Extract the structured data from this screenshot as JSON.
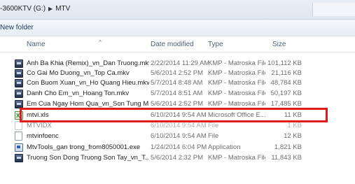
{
  "address": {
    "drive": "-3600KTV (G:)",
    "separator": "▶",
    "folder": "MTV"
  },
  "toolbar": {
    "new_folder_label": "New folder"
  },
  "columns": {
    "name": "Name",
    "date": "Date modified",
    "type": "Type",
    "size": "Size"
  },
  "files": [
    {
      "name": "Anh Ba Khia (Remix)_vn_Dan Truong.mkv",
      "date": "2/22/2014 11:29 AM",
      "type": "KMP - Matroska File",
      "size": "101,112 KB",
      "icon": "video-file-icon"
    },
    {
      "name": "Co Gai Mo Duong_vn_Top Ca.mkv",
      "date": "5/6/2014 2:52 PM",
      "type": "KMP - Matroska File",
      "size": "21,116 KB",
      "icon": "video-file-icon"
    },
    {
      "name": "Con Buom Xuan_vn_Ho Quang Hieu.mkv",
      "date": "5/7/2014 8:48 AM",
      "type": "KMP - Matroska File",
      "size": "48,784 KB",
      "icon": "video-file-icon"
    },
    {
      "name": "Danh Cho Em_vn_Hoang Ton.mkv",
      "date": "5/7/2014 8:51 AM",
      "type": "KMP - Matroska File",
      "size": "50,197 KB",
      "icon": "video-file-icon"
    },
    {
      "name": "Em Cua Ngay Hom Qua_vn_Son Tung M...",
      "date": "5/6/2014 2:52 PM",
      "type": "KMP - Matroska File",
      "size": "17,485 KB",
      "icon": "video-file-icon"
    },
    {
      "name": "mtvi.xls",
      "date": "6/10/2014 9:54 AM",
      "type": "Microsoft Office E...",
      "size": "11 KB",
      "icon": "excel-file-icon"
    },
    {
      "name": "MTVIDX",
      "date": "6/10/2014 9:54 AM",
      "type": "File",
      "size": "1 KB",
      "icon": "blank-file-icon"
    },
    {
      "name": "mtvinfoenc",
      "date": "6/10/2014 9:54 AM",
      "type": "File",
      "size": "12 KB",
      "icon": "blank-file-icon"
    },
    {
      "name": "MtvTools_gan trong_from8050001.exe",
      "date": "1/24/2014 6:04 PM",
      "type": "Application",
      "size": "1,821 KB",
      "icon": "application-icon"
    },
    {
      "name": "Truong Son Dong Truong Son Tay_vn_T...",
      "date": "5/6/2014 2:32 PM",
      "type": "KMP - Matroska File",
      "size": "11,843 KB",
      "icon": "video-file-icon"
    }
  ],
  "colors": {
    "highlight_box": "#e11b1b"
  }
}
